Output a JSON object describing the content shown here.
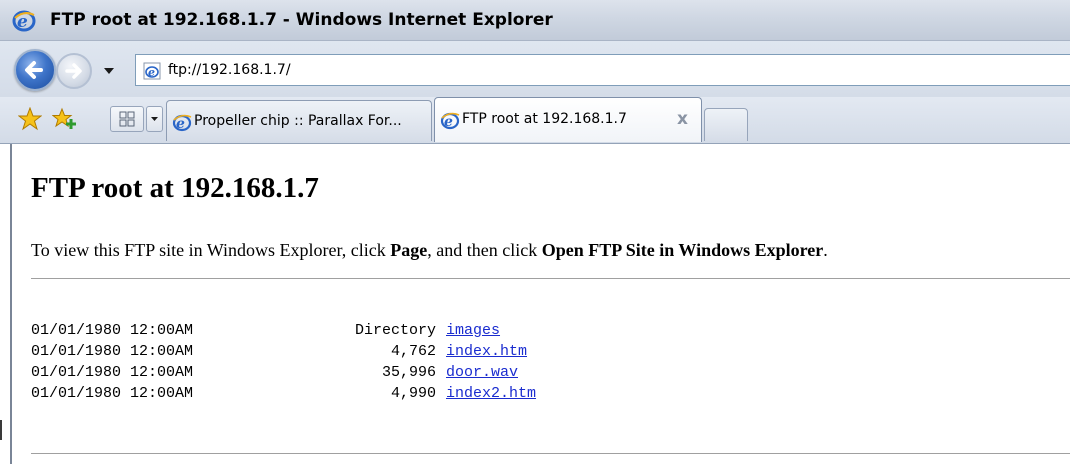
{
  "window": {
    "title": "FTP root at 192.168.1.7 - Windows Internet Explorer"
  },
  "navigation": {
    "address": "ftp://192.168.1.7/"
  },
  "tabs": [
    {
      "label": "Propeller chip :: Parallax For...",
      "active": false,
      "icon": "ie-icon"
    },
    {
      "label": "FTP root at 192.168.1.7",
      "active": true,
      "icon": "ie-icon",
      "close_label": "x"
    }
  ],
  "page": {
    "heading": "FTP root at 192.168.1.7",
    "instructions_parts": [
      {
        "text": "To view this FTP site in Windows Explorer, click ",
        "bold": false
      },
      {
        "text": "Page",
        "bold": true
      },
      {
        "text": ", and then click ",
        "bold": false
      },
      {
        "text": "Open FTP Site in Windows Explorer",
        "bold": true
      },
      {
        "text": ".",
        "bold": false
      }
    ],
    "files": [
      {
        "date": "01/01/1980 12:00AM",
        "size": "Directory",
        "name": "images"
      },
      {
        "date": "01/01/1980 12:00AM",
        "size": "4,762",
        "name": "index.htm"
      },
      {
        "date": "01/01/1980 12:00AM",
        "size": "35,996",
        "name": "door.wav"
      },
      {
        "date": "01/01/1980 12:00AM",
        "size": "4,990",
        "name": "index2.htm"
      }
    ]
  },
  "colors": {
    "link": "#1a2ccf",
    "chrome": "#d4dce8",
    "back_button": "#3e74c9"
  }
}
